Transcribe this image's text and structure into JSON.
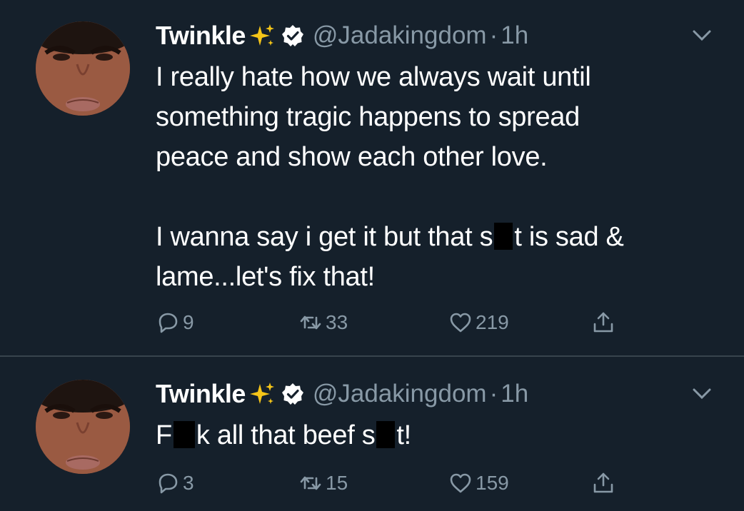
{
  "tweets": [
    {
      "display_name": "Twinkle",
      "handle": "@Jadakingdom",
      "separator": "·",
      "time": "1h",
      "text_line1": "I really hate how we always wait until",
      "text_line2": "something tragic happens to spread",
      "text_line3": "peace and show each other love.",
      "text_p2_a": "I wanna say i get it but that s",
      "text_p2_b": "t is sad &",
      "text_p2_line2": "lame...let's fix that!",
      "replies": "9",
      "retweets": "33",
      "likes": "219"
    },
    {
      "display_name": "Twinkle",
      "handle": "@Jadakingdom",
      "separator": "·",
      "time": "1h",
      "text_a": "F",
      "text_b": "k all that beef s",
      "text_c": "t!",
      "replies": "3",
      "retweets": "15",
      "likes": "159"
    }
  ],
  "icons": {
    "sparkle": "sparkles-emoji",
    "verified": "verified-badge-icon",
    "menu": "chevron-down-icon",
    "reply": "reply-icon",
    "retweet": "retweet-icon",
    "like": "heart-icon",
    "share": "share-icon"
  },
  "colors": {
    "background": "#15202b",
    "divider": "#38444d",
    "secondary_text": "#8899a6",
    "sparkle": "#f5c518"
  }
}
